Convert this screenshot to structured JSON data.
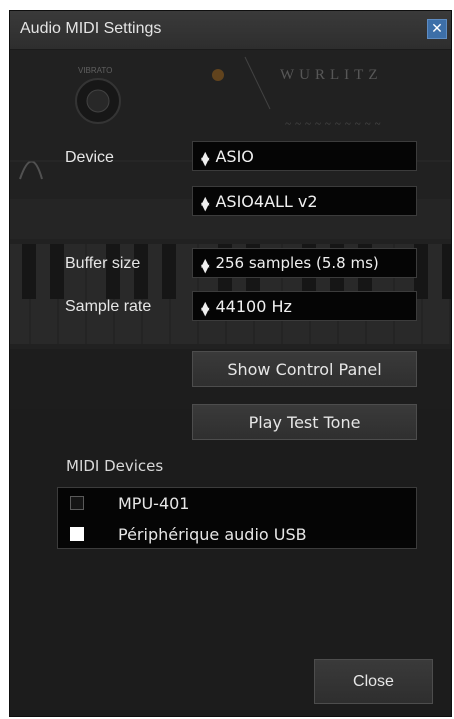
{
  "window": {
    "title": "Audio MIDI Settings"
  },
  "background": {
    "knob_label": "VIBRATO",
    "brand": "WURLITZ",
    "accent": "#c07a20"
  },
  "audio": {
    "device_label": "Device",
    "device_value": "ASIO",
    "driver_value": "ASIO4ALL v2",
    "buffer_label": "Buffer size",
    "buffer_value": "256 samples (5.8 ms)",
    "rate_label": "Sample rate",
    "rate_value": "44100 Hz"
  },
  "buttons": {
    "control_panel": "Show Control Panel",
    "test_tone": "Play Test Tone",
    "close": "Close"
  },
  "midi": {
    "title": "MIDI Devices",
    "devices": [
      {
        "name": "MPU-401",
        "checked": false
      },
      {
        "name": "Périphérique audio USB",
        "checked": true
      }
    ]
  },
  "icons": {
    "close": "close-icon",
    "select": "updown-arrows-icon",
    "checkbox": "checkbox-icon"
  }
}
